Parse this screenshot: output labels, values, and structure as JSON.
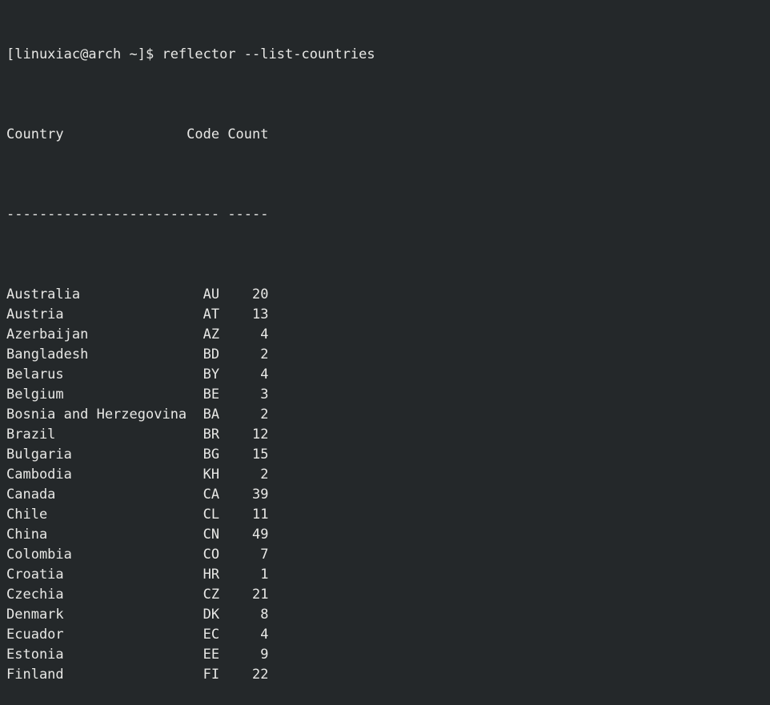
{
  "terminal": {
    "colors": {
      "background": "#24282a",
      "foreground": "#e8e8e6"
    },
    "prompt": {
      "full_line": "[linuxiac@arch ~]$ reflector --list-countries",
      "user_host": "[linuxiac@arch ~]$",
      "command": "reflector --list-countries"
    },
    "table": {
      "headers": {
        "country": "Country",
        "code": "Code",
        "count": "Count"
      },
      "separator": {
        "country": "----------------------",
        "code": "----",
        "count": "-----"
      },
      "rows": [
        {
          "country": "Australia",
          "code": "AU",
          "count": "20"
        },
        {
          "country": "Austria",
          "code": "AT",
          "count": "13"
        },
        {
          "country": "Azerbaijan",
          "code": "AZ",
          "count": "4"
        },
        {
          "country": "Bangladesh",
          "code": "BD",
          "count": "2"
        },
        {
          "country": "Belarus",
          "code": "BY",
          "count": "4"
        },
        {
          "country": "Belgium",
          "code": "BE",
          "count": "3"
        },
        {
          "country": "Bosnia and Herzegovina",
          "code": "BA",
          "count": "2"
        },
        {
          "country": "Brazil",
          "code": "BR",
          "count": "12"
        },
        {
          "country": "Bulgaria",
          "code": "BG",
          "count": "15"
        },
        {
          "country": "Cambodia",
          "code": "KH",
          "count": "2"
        },
        {
          "country": "Canada",
          "code": "CA",
          "count": "39"
        },
        {
          "country": "Chile",
          "code": "CL",
          "count": "11"
        },
        {
          "country": "China",
          "code": "CN",
          "count": "49"
        },
        {
          "country": "Colombia",
          "code": "CO",
          "count": "7"
        },
        {
          "country": "Croatia",
          "code": "HR",
          "count": "1"
        },
        {
          "country": "Czechia",
          "code": "CZ",
          "count": "21"
        },
        {
          "country": "Denmark",
          "code": "DK",
          "count": "8"
        },
        {
          "country": "Ecuador",
          "code": "EC",
          "count": "4"
        },
        {
          "country": "Estonia",
          "code": "EE",
          "count": "9"
        },
        {
          "country": "Finland",
          "code": "FI",
          "count": "22"
        }
      ]
    }
  }
}
